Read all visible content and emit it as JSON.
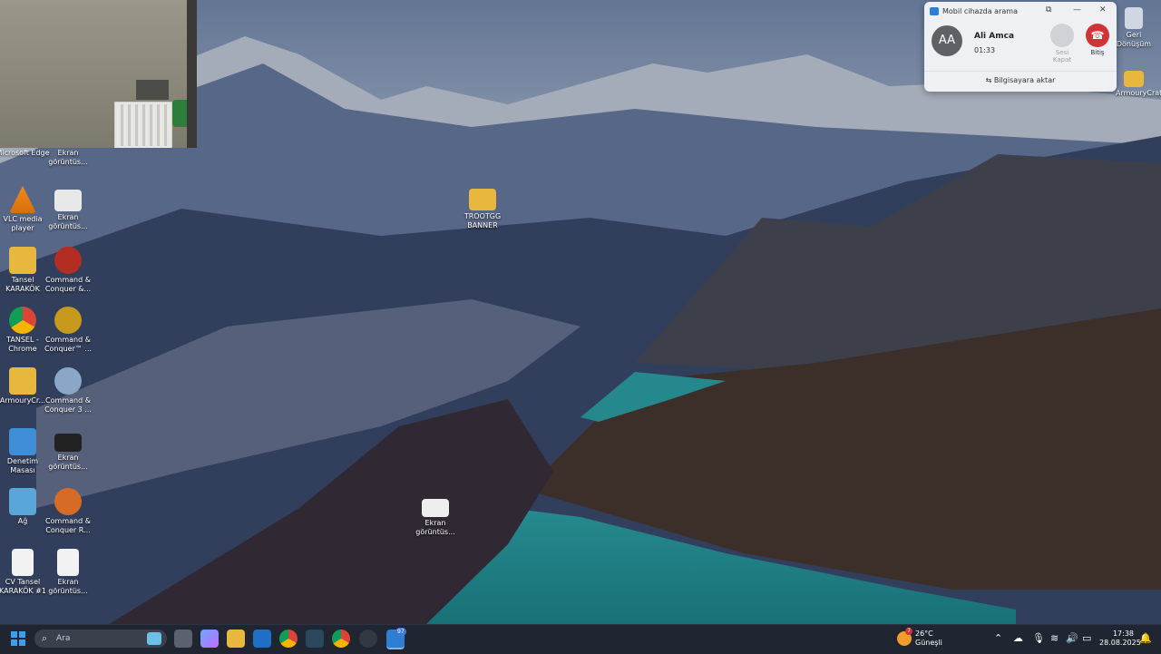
{
  "desktop": {
    "icons": [
      {
        "label": "Microsoft Edge"
      },
      {
        "label": "Ekran görüntüs..."
      },
      {
        "label": "VLC media player"
      },
      {
        "label": "Ekran görüntüs..."
      },
      {
        "label": "Tansel KARAKÖK"
      },
      {
        "label": "Command & Conquer &..."
      },
      {
        "label": "TANSEL - Chrome"
      },
      {
        "label": "Command & Conquer™ ..."
      },
      {
        "label": "ArmouryCr..."
      },
      {
        "label": "Command & Conquer 3 ..."
      },
      {
        "label": "Denetim Masası"
      },
      {
        "label": "Ekran görüntüs..."
      },
      {
        "label": "Ağ"
      },
      {
        "label": "Command & Conquer R..."
      },
      {
        "label": "CV Tansel KARAKÖK #1"
      },
      {
        "label": "Ekran görüntüs..."
      },
      {
        "label": "TROOTGG BANNER"
      },
      {
        "label": "Ekran görüntüs..."
      },
      {
        "label": "Geri Dönüşüm"
      },
      {
        "label": "ArmouryCrate"
      }
    ]
  },
  "call_popup": {
    "title": "Mobil cihazda arama",
    "avatar_initials": "AA",
    "contact_name": "Ali Amca",
    "duration": "01:33",
    "mute_label": "Sesi Kapat",
    "end_label": "Bitiş",
    "transfer_label": "Bilgisayara aktar",
    "controls": [
      "⧉",
      "—",
      "✕"
    ]
  },
  "taskbar": {
    "search_placeholder": "Ara",
    "badge_count": "97",
    "weather_temp": "26°C",
    "weather_desc": "Güneşli",
    "weather_badge": "7",
    "time": "17:38",
    "date": "28.08.2025"
  }
}
